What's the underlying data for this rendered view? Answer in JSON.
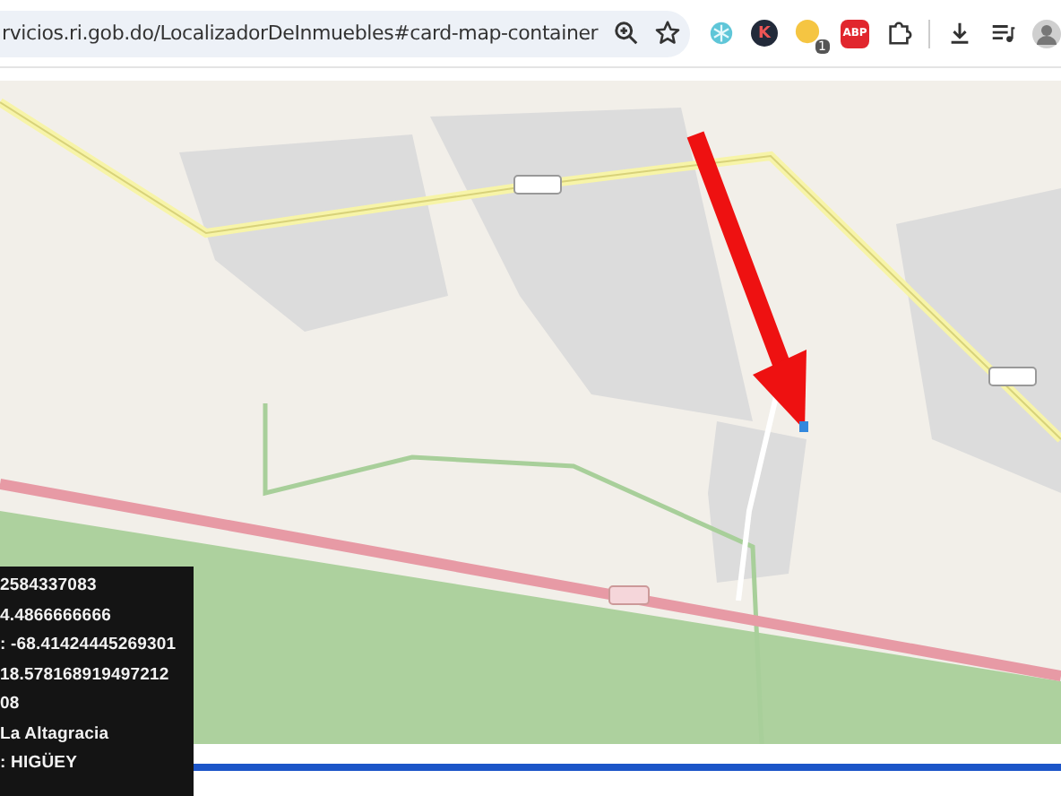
{
  "address_bar": {
    "url": "rvicios.ri.gob.do/LocalizadorDeInmuebles#card-map-container"
  },
  "toolbar": {
    "profile_extension_letter": "K",
    "extension_badge": "1",
    "adblock_label": "ABP"
  },
  "info_panel": {
    "lines": [
      "2584337083",
      "4.4866666666",
      ": -68.41424445269301",
      "18.578168919497212",
      "08",
      "La Altagracia",
      ": HIGÜEY"
    ]
  }
}
